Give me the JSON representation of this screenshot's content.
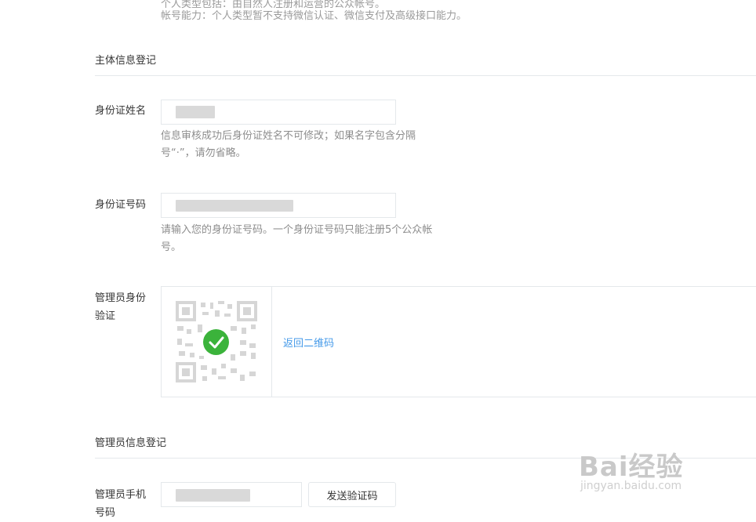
{
  "top_notes": {
    "line1": "个人类型包括：由自然人注册和运营的公众帐号。",
    "line2": "帐号能力：个人类型暂不支持微信认证、微信支付及高级接口能力。"
  },
  "subject_section": {
    "title": "主体信息登记",
    "id_name_label": "身份证姓名",
    "id_name_tip": "信息审核成功后身份证姓名不可修改；如果名字包含分隔号“·”，请勿省略。",
    "id_number_label": "身份证号码",
    "id_number_tip": "请输入您的身份证号码。一个身份证号码只能注册5个公众帐号。",
    "admin_verify_label": "管理员身份验证",
    "return_qr_link": "返回二维码"
  },
  "admin_section": {
    "title": "管理员信息登记",
    "phone_label": "管理员手机号码",
    "send_code_button": "发送验证码"
  },
  "watermark": {
    "text": "Bai经验",
    "sub": "jingyan.baidu.com"
  },
  "colors": {
    "text": "#353535",
    "tip": "#8d8d8d",
    "border": "#e4e8eb",
    "link": "#459ae9",
    "success": "#3bb33b"
  }
}
